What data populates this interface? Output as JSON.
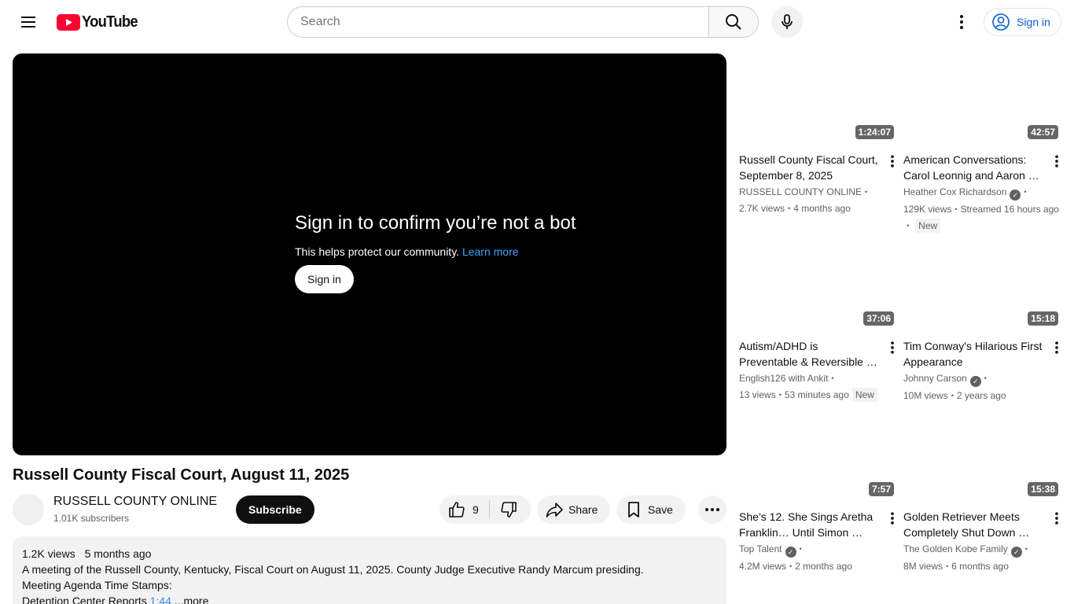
{
  "header": {
    "logo_text": "YouTube",
    "search_placeholder": "Search",
    "signin_label": "Sign in"
  },
  "player": {
    "bot_title": "Sign in to confirm you’re not a bot",
    "bot_sub": "This helps protect our community.",
    "learn_more": "Learn more",
    "signin_label": "Sign in"
  },
  "video": {
    "title": "Russell County Fiscal Court, August 11, 2025",
    "channel": "RUSSELL COUNTY ONLINE",
    "subscribers": "1.01K subscribers",
    "subscribe_label": "Subscribe",
    "likes": "9",
    "share_label": "Share",
    "save_label": "Save"
  },
  "description": {
    "views": "1.2K views",
    "age": "5 months ago",
    "line1": "A meeting of the Russell County, Kentucky, Fiscal Court on August 11, 2025. County Judge Executive Randy Marcum presiding.",
    "line2": "Meeting Agenda Time Stamps:",
    "line3_text": "Detention Center Reports",
    "line3_link": "1:44",
    "more_label": "...more"
  },
  "recommendations": [
    {
      "duration": "1:24:07",
      "title": "Russell County Fiscal Court, September 8, 2025",
      "channel": "RUSSELL COUNTY ONLINE",
      "views": "2.7K views",
      "age": "4 months ago"
    },
    {
      "duration": "42:57",
      "title": "American Conversations: Carol Leonnig and Aaron …",
      "channel": "Heather Cox Richardson",
      "views": "129K views",
      "age": "Streamed 16 hours ago",
      "badge": "New"
    },
    {
      "duration": "37:06",
      "title": "Autism/ADHD is Preventable & Reversible …",
      "channel": "English126 with Ankit",
      "views": "13 views",
      "age": "53 minutes ago",
      "badge": "New"
    },
    {
      "duration": "15:18",
      "title": "Tim Conway's Hilarious First Appearance",
      "channel": "Johnny Carson",
      "views": "10M views",
      "age": "2 years ago"
    },
    {
      "duration": "7:57",
      "title": "She’s 12. She Sings Aretha Franklin… Until Simon …",
      "channel": "Top Talent",
      "views": "4.2M views",
      "age": "2 months ago"
    },
    {
      "duration": "15:38",
      "title": "Golden Retriever Meets Completely Shut Down …",
      "channel": "The Golden Kobe Family",
      "views": "8M views",
      "age": "6 months ago"
    }
  ],
  "colors": {
    "brand_red": "#ff0033",
    "link_blue": "#065fd4",
    "player_bg": "#000000"
  }
}
